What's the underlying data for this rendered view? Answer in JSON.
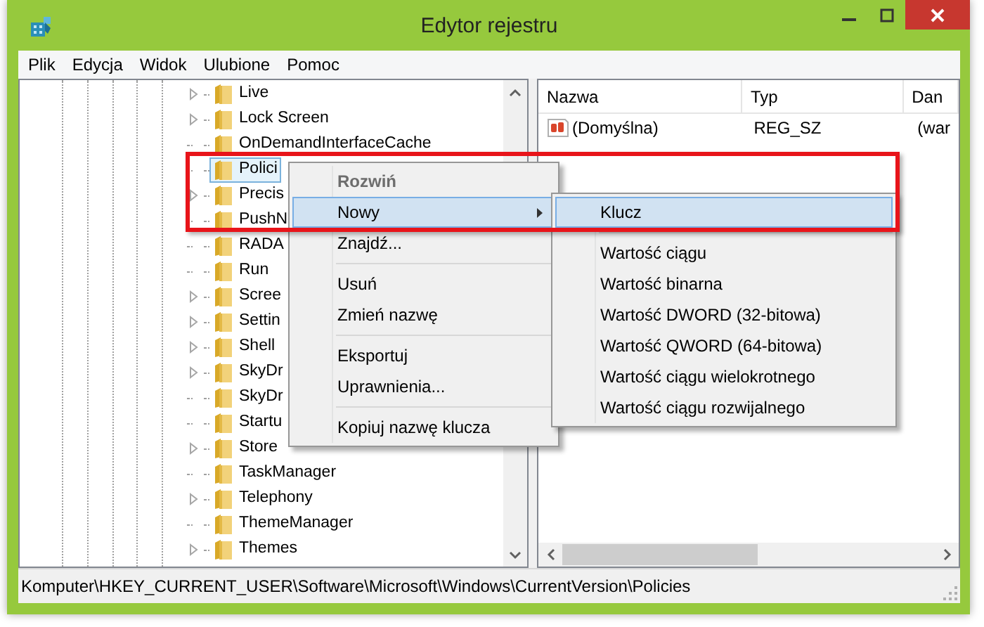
{
  "window": {
    "title": "Edytor rejestru"
  },
  "menu_bar": [
    "Plik",
    "Edycja",
    "Widok",
    "Ulubione",
    "Pomoc"
  ],
  "tree": {
    "items": [
      {
        "label": "Live",
        "expandable": true,
        "selected": false
      },
      {
        "label": "Lock Screen",
        "expandable": true,
        "selected": false
      },
      {
        "label": "OnDemandInterfaceCache",
        "expandable": false,
        "selected": false
      },
      {
        "label": "Polici",
        "expandable": false,
        "selected": true
      },
      {
        "label": "Precis",
        "expandable": true,
        "selected": false
      },
      {
        "label": "PushN",
        "expandable": false,
        "selected": false
      },
      {
        "label": "RADA",
        "expandable": false,
        "selected": false
      },
      {
        "label": "Run",
        "expandable": false,
        "selected": false
      },
      {
        "label": "Scree",
        "expandable": true,
        "selected": false
      },
      {
        "label": "Settin",
        "expandable": true,
        "selected": false
      },
      {
        "label": "Shell",
        "expandable": true,
        "selected": false
      },
      {
        "label": "SkyDr",
        "expandable": true,
        "selected": false
      },
      {
        "label": "SkyDr",
        "expandable": false,
        "selected": false
      },
      {
        "label": "Startu",
        "expandable": false,
        "selected": false
      },
      {
        "label": "Store",
        "expandable": true,
        "selected": false
      },
      {
        "label": "TaskManager",
        "expandable": false,
        "selected": false
      },
      {
        "label": "Telephony",
        "expandable": true,
        "selected": false
      },
      {
        "label": "ThemeManager",
        "expandable": false,
        "selected": false
      },
      {
        "label": "Themes",
        "expandable": true,
        "selected": false
      }
    ]
  },
  "values": {
    "columns": [
      "Nazwa",
      "Typ",
      "Dan"
    ],
    "rows": [
      {
        "name": "(Domyślna)",
        "type": "REG_SZ",
        "data": "(war"
      }
    ]
  },
  "context_menu": {
    "items": [
      {
        "kind": "item",
        "label": "Rozwiń",
        "default": true,
        "disabled": true,
        "selected": false,
        "submenu": false
      },
      {
        "kind": "item",
        "label": "Nowy",
        "default": false,
        "disabled": false,
        "selected": true,
        "submenu": true
      },
      {
        "kind": "item",
        "label": "Znajdź...",
        "default": false,
        "disabled": false,
        "selected": false,
        "submenu": false
      },
      {
        "kind": "separator"
      },
      {
        "kind": "item",
        "label": "Usuń",
        "default": false,
        "disabled": false,
        "selected": false,
        "submenu": false
      },
      {
        "kind": "item",
        "label": "Zmień nazwę",
        "default": false,
        "disabled": false,
        "selected": false,
        "submenu": false
      },
      {
        "kind": "separator"
      },
      {
        "kind": "item",
        "label": "Eksportuj",
        "default": false,
        "disabled": false,
        "selected": false,
        "submenu": false
      },
      {
        "kind": "item",
        "label": "Uprawnienia...",
        "default": false,
        "disabled": false,
        "selected": false,
        "submenu": false
      },
      {
        "kind": "separator"
      },
      {
        "kind": "item",
        "label": "Kopiuj nazwę klucza",
        "default": false,
        "disabled": false,
        "selected": false,
        "submenu": false
      }
    ]
  },
  "submenu": {
    "items": [
      {
        "kind": "item",
        "label": "Klucz",
        "selected": true
      },
      {
        "kind": "separator"
      },
      {
        "kind": "item",
        "label": "Wartość ciągu",
        "selected": false
      },
      {
        "kind": "item",
        "label": "Wartość binarna",
        "selected": false
      },
      {
        "kind": "item",
        "label": "Wartość DWORD (32-bitowa)",
        "selected": false
      },
      {
        "kind": "item",
        "label": "Wartość QWORD (64-bitowa)",
        "selected": false
      },
      {
        "kind": "item",
        "label": "Wartość ciągu wielokrotnego",
        "selected": false
      },
      {
        "kind": "item",
        "label": "Wartość ciągu rozwijalnego",
        "selected": false
      }
    ]
  },
  "status_bar": "Komputer\\HKEY_CURRENT_USER\\Software\\Microsoft\\Windows\\CurrentVersion\\Policies"
}
